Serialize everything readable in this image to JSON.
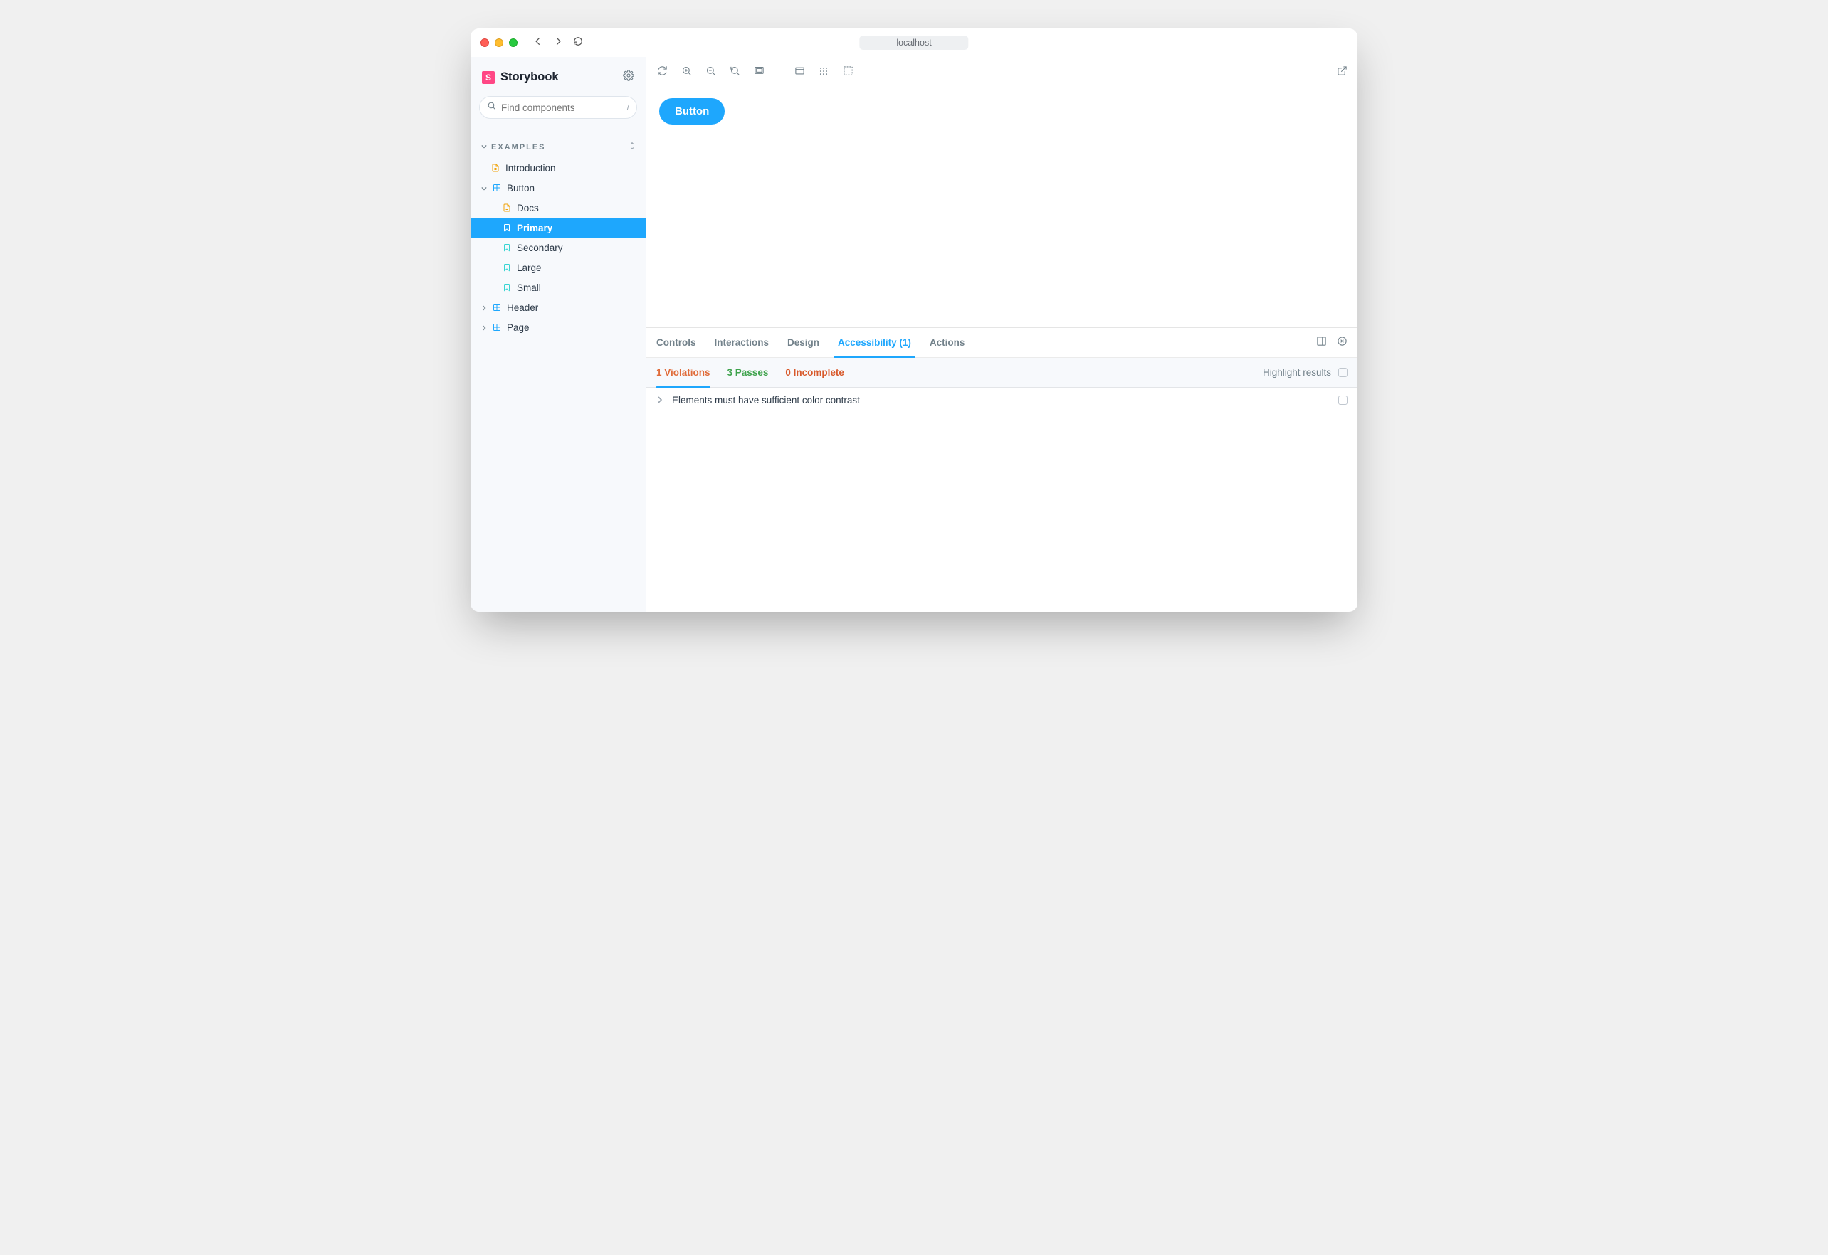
{
  "titlebar": {
    "address": "localhost"
  },
  "sidebar": {
    "brand": "Storybook",
    "search_placeholder": "Find components",
    "search_shortcut": "/",
    "section": "EXAMPLES",
    "tree": {
      "introduction": "Introduction",
      "button": "Button",
      "docs": "Docs",
      "primary": "Primary",
      "secondary": "Secondary",
      "large": "Large",
      "small": "Small",
      "header": "Header",
      "page": "Page"
    }
  },
  "canvas": {
    "button_label": "Button"
  },
  "addons": {
    "tabs": {
      "controls": "Controls",
      "interactions": "Interactions",
      "design": "Design",
      "accessibility": "Accessibility (1)",
      "actions": "Actions"
    },
    "a11y": {
      "violations": "1 Violations",
      "passes": "3 Passes",
      "incomplete": "0 Incomplete",
      "highlight": "Highlight results",
      "items": [
        "Elements must have sufficient color contrast"
      ]
    }
  }
}
